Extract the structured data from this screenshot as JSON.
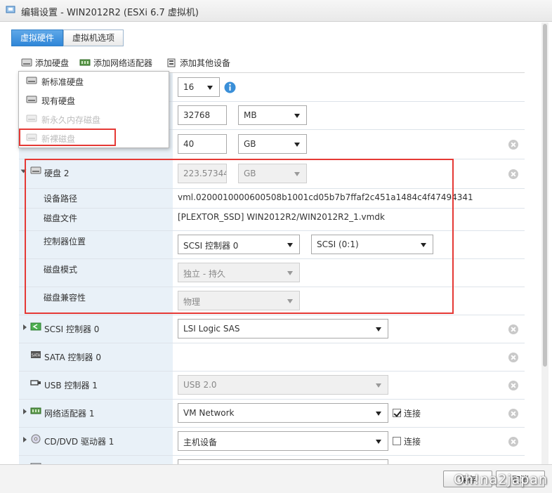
{
  "window": {
    "title": "编辑设置 - WIN2012R2 (ESXi 6.7 虚拟机)"
  },
  "tabs": [
    {
      "label": "虚拟硬件",
      "active": true
    },
    {
      "label": "虚拟机选项",
      "active": false
    }
  ],
  "toolbar": {
    "add_disk": "添加硬盘",
    "add_network": "添加网络适配器",
    "add_other": "添加其他设备"
  },
  "add_disk_menu": {
    "items": [
      {
        "label": "新标准硬盘",
        "enabled": true
      },
      {
        "label": "现有硬盘",
        "enabled": true
      },
      {
        "label": "新永久内存磁盘",
        "enabled": false
      },
      {
        "label": "新裸磁盘",
        "enabled": false
      }
    ]
  },
  "hardware": {
    "cpu": {
      "value": "16",
      "info_icon": "info-icon"
    },
    "memory": {
      "value": "32768",
      "unit": "MB"
    },
    "hard_disk_1": {
      "value": "40",
      "unit": "GB"
    },
    "hard_disk_2": {
      "label": "硬盘 2",
      "size": "223.57344",
      "unit": "GB",
      "disk_path_label": "设备路径",
      "disk_path": "vml.0200010000600508b1001cd05b7b7ffaf2c451a1484c4f47494341",
      "disk_file_label": "磁盘文件",
      "disk_file": "[PLEXTOR_SSD] WIN2012R2/WIN2012R2_1.vmdk",
      "controller_location_label": "控制器位置",
      "controller": "SCSI 控制器 0",
      "controller_slot": "SCSI (0:1)",
      "disk_mode_label": "磁盘模式",
      "disk_mode": "独立 - 持久",
      "compat_label": "磁盘兼容性",
      "compat": "物理"
    },
    "scsi_controller": {
      "label": "SCSI 控制器 0",
      "value": "LSI Logic SAS"
    },
    "sata_controller": {
      "label": "SATA 控制器 0"
    },
    "usb_controller": {
      "label": "USB 控制器 1",
      "value": "USB 2.0"
    },
    "network_adapter": {
      "label": "网络适配器 1",
      "value": "VM Network",
      "connect_label": "连接",
      "connected": true
    },
    "cd_dvd": {
      "label": "CD/DVD 驱动器 1",
      "value": "主机设备",
      "connect_label": "连接",
      "connected": false
    },
    "video_card": {
      "label": "显卡"
    }
  },
  "footer": {
    "save": "保存",
    "cancel": "取消"
  },
  "watermark": "Oh!na2japan",
  "colors": {
    "accent": "#2f86d8",
    "highlight": "#e53935",
    "left_column": "#e9f1f8"
  }
}
